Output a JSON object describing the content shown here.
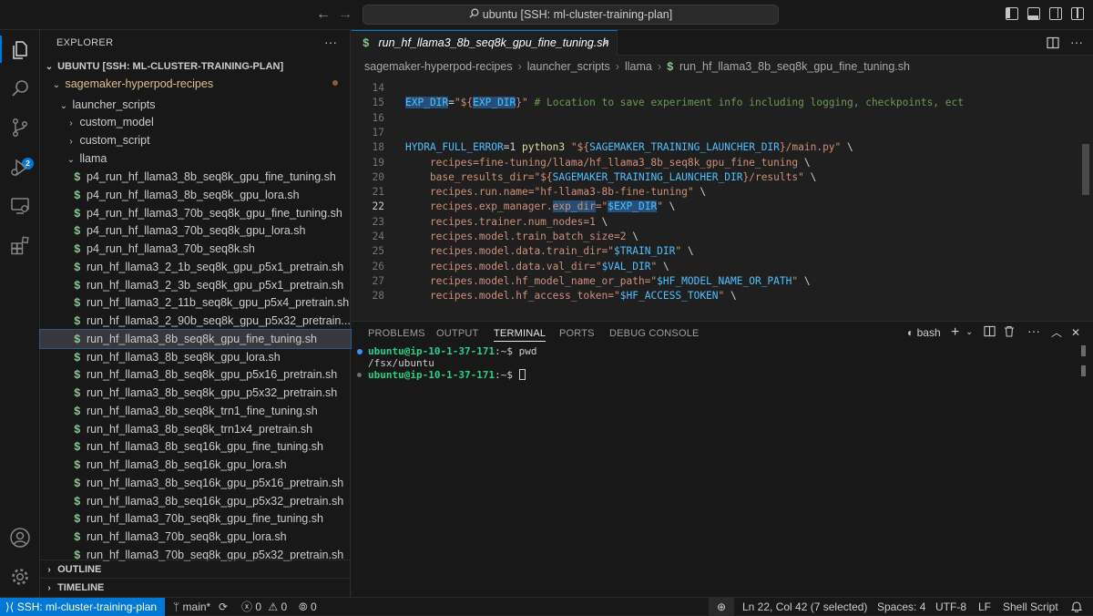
{
  "title_bar": {
    "search_text": "ubuntu [SSH: ml-cluster-training-plan]",
    "back_icon": "arrow-left-icon",
    "forward_icon": "arrow-right-icon"
  },
  "activity_bar": {
    "source_control_badge": "2"
  },
  "sidebar": {
    "header": "EXPLORER",
    "more": "···",
    "workspace": "UBUNTU [SSH: ML-CLUSTER-TRAINING-PLAN]",
    "root_folder": "sagemaker-hyperpod-recipes",
    "launcher_scripts": "launcher_scripts",
    "custom_model": "custom_model",
    "custom_script": "custom_script",
    "llama": "llama",
    "files": [
      "p4_run_hf_llama3_8b_seq8k_gpu_fine_tuning.sh",
      "p4_run_hf_llama3_8b_seq8k_gpu_lora.sh",
      "p4_run_hf_llama3_70b_seq8k_gpu_fine_tuning.sh",
      "p4_run_hf_llama3_70b_seq8k_gpu_lora.sh",
      "p4_run_hf_llama3_70b_seq8k.sh",
      "run_hf_llama3_2_1b_seq8k_gpu_p5x1_pretrain.sh",
      "run_hf_llama3_2_3b_seq8k_gpu_p5x1_pretrain.sh",
      "run_hf_llama3_2_11b_seq8k_gpu_p5x4_pretrain.sh",
      "run_hf_llama3_2_90b_seq8k_gpu_p5x32_pretrain...",
      "run_hf_llama3_8b_seq8k_gpu_fine_tuning.sh",
      "run_hf_llama3_8b_seq8k_gpu_lora.sh",
      "run_hf_llama3_8b_seq8k_gpu_p5x16_pretrain.sh",
      "run_hf_llama3_8b_seq8k_gpu_p5x32_pretrain.sh",
      "run_hf_llama3_8b_seq8k_trn1_fine_tuning.sh",
      "run_hf_llama3_8b_seq8k_trn1x4_pretrain.sh",
      "run_hf_llama3_8b_seq16k_gpu_fine_tuning.sh",
      "run_hf_llama3_8b_seq16k_gpu_lora.sh",
      "run_hf_llama3_8b_seq16k_gpu_p5x16_pretrain.sh",
      "run_hf_llama3_8b_seq16k_gpu_p5x32_pretrain.sh",
      "run_hf_llama3_70b_seq8k_gpu_fine_tuning.sh",
      "run_hf_llama3_70b_seq8k_gpu_lora.sh",
      "run_hf_llama3_70b_seq8k_gpu_p5x32_pretrain.sh"
    ],
    "selected_index": 9,
    "outline": "OUTLINE",
    "timeline": "TIMELINE"
  },
  "editor": {
    "tab_label": "run_hf_llama3_8b_seq8k_gpu_fine_tuning.sh",
    "tab_close": "×",
    "breadcrumb": [
      "sagemaker-hyperpod-recipes",
      "launcher_scripts",
      "llama",
      "run_hf_llama3_8b_seq8k_gpu_fine_tuning.sh"
    ],
    "lines": [
      {
        "n": "14",
        "segs": []
      },
      {
        "n": "15",
        "segs": [
          {
            "t": "EXP_DIR",
            "c": "v hl"
          },
          {
            "t": "=",
            "c": "o"
          },
          {
            "t": "\"${",
            "c": "s"
          },
          {
            "t": "EXP_DIR",
            "c": "v hl"
          },
          {
            "t": "}\"",
            "c": "s"
          },
          {
            "t": " # Location to save experiment info including logging, checkpoints, ect",
            "c": "c"
          }
        ]
      },
      {
        "n": "16",
        "segs": []
      },
      {
        "n": "17",
        "segs": []
      },
      {
        "n": "18",
        "segs": [
          {
            "t": "HYDRA_FULL_ERROR",
            "c": "v"
          },
          {
            "t": "=1 ",
            "c": "o"
          },
          {
            "t": "python3",
            "c": "k"
          },
          {
            "t": " \"${",
            "c": "s"
          },
          {
            "t": "SAGEMAKER_TRAINING_LAUNCHER_DIR",
            "c": "v"
          },
          {
            "t": "}/main.py\"",
            "c": "s"
          },
          {
            "t": " \\",
            "c": "o"
          }
        ]
      },
      {
        "n": "19",
        "segs": [
          {
            "t": "    recipes=fine-tuning/llama/hf_llama3_8b_seq8k_gpu_fine_tuning",
            "c": "s"
          },
          {
            "t": " \\",
            "c": "o"
          }
        ]
      },
      {
        "n": "20",
        "segs": [
          {
            "t": "    base_results_dir=",
            "c": "s"
          },
          {
            "t": "\"${",
            "c": "s"
          },
          {
            "t": "SAGEMAKER_TRAINING_LAUNCHER_DIR",
            "c": "v"
          },
          {
            "t": "}/results\"",
            "c": "s"
          },
          {
            "t": " \\",
            "c": "o"
          }
        ]
      },
      {
        "n": "21",
        "segs": [
          {
            "t": "    recipes.run.name=",
            "c": "s"
          },
          {
            "t": "\"hf-llama3-8b-fine-tuning\"",
            "c": "s"
          },
          {
            "t": " \\",
            "c": "o"
          }
        ]
      },
      {
        "n": "22",
        "cur": true,
        "segs": [
          {
            "t": "    recipes.exp_manager.",
            "c": "s"
          },
          {
            "t": "exp_dir",
            "c": "s hl"
          },
          {
            "t": "=\"",
            "c": "s"
          },
          {
            "t": "$EXP_DIR",
            "c": "v hl"
          },
          {
            "t": "\"",
            "c": "s"
          },
          {
            "t": " \\",
            "c": "o"
          }
        ]
      },
      {
        "n": "23",
        "segs": [
          {
            "t": "    recipes.trainer.num_nodes=1",
            "c": "s"
          },
          {
            "t": " \\",
            "c": "o"
          }
        ]
      },
      {
        "n": "24",
        "segs": [
          {
            "t": "    recipes.model.train_batch_size=2",
            "c": "s"
          },
          {
            "t": " \\",
            "c": "o"
          }
        ]
      },
      {
        "n": "25",
        "segs": [
          {
            "t": "    recipes.model.data.train_dir=",
            "c": "s"
          },
          {
            "t": "\"",
            "c": "s"
          },
          {
            "t": "$TRAIN_DIR",
            "c": "v"
          },
          {
            "t": "\"",
            "c": "s"
          },
          {
            "t": " \\",
            "c": "o"
          }
        ]
      },
      {
        "n": "26",
        "segs": [
          {
            "t": "    recipes.model.data.val_dir=",
            "c": "s"
          },
          {
            "t": "\"",
            "c": "s"
          },
          {
            "t": "$VAL_DIR",
            "c": "v"
          },
          {
            "t": "\"",
            "c": "s"
          },
          {
            "t": " \\",
            "c": "o"
          }
        ]
      },
      {
        "n": "27",
        "segs": [
          {
            "t": "    recipes.model.hf_model_name_or_path=",
            "c": "s"
          },
          {
            "t": "\"",
            "c": "s"
          },
          {
            "t": "$HF_MODEL_NAME_OR_PATH",
            "c": "v"
          },
          {
            "t": "\"",
            "c": "s"
          },
          {
            "t": " \\",
            "c": "o"
          }
        ]
      },
      {
        "n": "28",
        "segs": [
          {
            "t": "    recipes.model.hf_access_token=",
            "c": "s"
          },
          {
            "t": "\"",
            "c": "s"
          },
          {
            "t": "$HF_ACCESS_TOKEN",
            "c": "v"
          },
          {
            "t": "\"",
            "c": "s"
          },
          {
            "t": " \\",
            "c": "o"
          }
        ]
      }
    ]
  },
  "panel": {
    "tabs": [
      "PROBLEMS",
      "OUTPUT",
      "TERMINAL",
      "PORTS",
      "DEBUG CONSOLE"
    ],
    "active_tab": "TERMINAL",
    "shell": "bash",
    "terminal": {
      "prompt": "ubuntu@ip-10-1-37-171",
      "path": ":~$",
      "cmd1": " pwd",
      "output1": "/fsx/ubuntu"
    }
  },
  "status_bar": {
    "remote": "SSH: ml-cluster-training-plan",
    "branch": "main*",
    "errors": "0",
    "warnings": "0",
    "ports": "0",
    "position": "Ln 22, Col 42 (7 selected)",
    "spaces": "Spaces: 4",
    "encoding": "UTF-8",
    "eol": "LF",
    "language": "Shell Script"
  },
  "colors": {
    "accent": "#0078d4",
    "terminal_prompt": "#23d18b",
    "file_icon": "#8dc891"
  }
}
